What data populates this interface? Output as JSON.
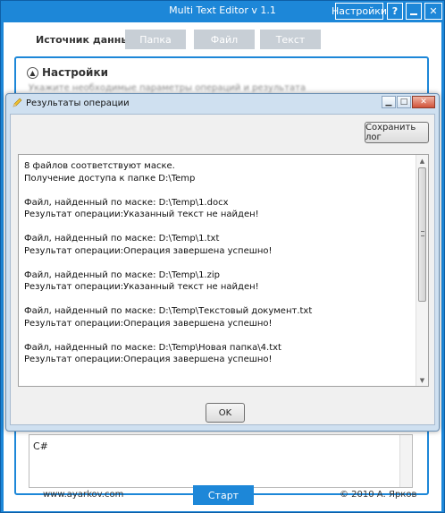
{
  "app": {
    "title": "Multi Text Editor v 1.1",
    "settings_button": "Настройки",
    "help_button": "?",
    "close_button": "✕"
  },
  "source": {
    "label": "Источник данных",
    "buttons": [
      "Папка",
      "Файл",
      "Текст"
    ]
  },
  "settings": {
    "header": "Настройки",
    "header_icon": "chevron-up-icon",
    "subtitle": "Укажите необходимые параметры операций и результата"
  },
  "background_text_area": {
    "language": "C#"
  },
  "footer": {
    "site": "www.ayarkov.com",
    "start_button": "Старт",
    "copyright": "© 2010 А. Ярков"
  },
  "dialog": {
    "title": "Результаты операции",
    "title_icon": "pencil-icon",
    "save_log_button": "Сохранить лог",
    "ok_button": "OK",
    "log_lines": [
      "8 файлов соответствуют маске.",
      "Получение доступа к папке D:\\Temp",
      "",
      "Файл, найденный по маске: D:\\Temp\\1.docx",
      "Результат операции:Указанный текст не найден!",
      "",
      "Файл, найденный по маске: D:\\Temp\\1.txt",
      "Результат операции:Операция завершена успешно!",
      "",
      "Файл, найденный по маске: D:\\Temp\\1.zip",
      "Результат операции:Указанный текст не найден!",
      "",
      "Файл, найденный по маске: D:\\Temp\\Текстовый документ.txt",
      "Результат операции:Операция завершена успешно!",
      "",
      "Файл, найденный по маске: D:\\Temp\\Новая папка\\4.txt",
      "Результат операции:Операция завершена успешно!"
    ]
  },
  "colors": {
    "accent": "#1d87d8",
    "disabled_button": "#c8cfd6"
  }
}
